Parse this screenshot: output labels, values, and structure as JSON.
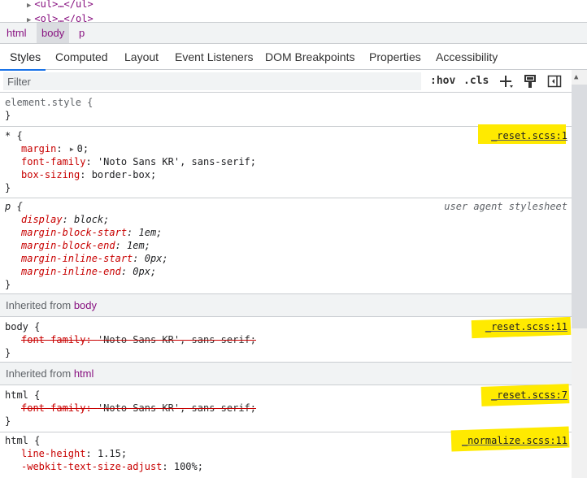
{
  "dom_peek": {
    "line1": "<ul>…</ul>",
    "line2": "<ol>…</ol>"
  },
  "breadcrumb": [
    "html",
    "body",
    "p"
  ],
  "tabs": [
    "Styles",
    "Computed",
    "Layout",
    "Event Listeners",
    "DOM Breakpoints",
    "Properties",
    "Accessibility"
  ],
  "filter": {
    "placeholder": "Filter",
    "hov": ":hov",
    "cls": ".cls",
    "icons": [
      "plus-icon",
      "paint-icon",
      "sidebar-toggle-icon"
    ]
  },
  "rules": {
    "element_style": {
      "open": "element.style {",
      "close": "}"
    },
    "universal": {
      "selector": "* {",
      "source": "_reset.scss:1",
      "props": [
        {
          "name": "margin",
          "value": "0;",
          "expandable": true
        },
        {
          "name": "font-family",
          "value": "'Noto Sans KR', sans-serif;"
        },
        {
          "name": "box-sizing",
          "value": "border-box;"
        }
      ],
      "close": "}"
    },
    "p_ua": {
      "selector": "p {",
      "source": "user agent stylesheet",
      "props": [
        {
          "name": "display",
          "value": "block;"
        },
        {
          "name": "margin-block-start",
          "value": "1em;"
        },
        {
          "name": "margin-block-end",
          "value": "1em;"
        },
        {
          "name": "margin-inline-start",
          "value": "0px;"
        },
        {
          "name": "margin-inline-end",
          "value": "0px;"
        }
      ],
      "close": "}"
    },
    "inherited_body": {
      "label": "Inherited from",
      "element": "body",
      "selector": "body {",
      "source": "_reset.scss:11",
      "props": [
        {
          "name": "font-family",
          "value": "'Noto Sans KR', sans-serif;"
        }
      ],
      "close": "}"
    },
    "inherited_html": {
      "label": "Inherited from",
      "element": "html",
      "selector": "html {",
      "source": "_reset.scss:7",
      "props": [
        {
          "name": "font-family",
          "value": "'Noto Sans KR', sans-serif;"
        }
      ],
      "close": "}"
    },
    "html_normalize": {
      "selector": "html {",
      "source": "_normalize.scss:11",
      "props": [
        {
          "name": "line-height",
          "value": "1.15;"
        },
        {
          "name": "-webkit-text-size-adjust",
          "value": "100%;"
        }
      ]
    }
  },
  "colors": {
    "highlight": "#ffea00",
    "prop_name": "#c80000",
    "tag": "#881280",
    "active_tab": "#1a73e8"
  }
}
